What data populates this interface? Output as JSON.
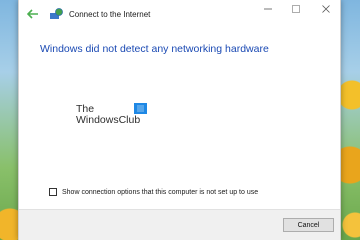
{
  "window": {
    "title": "Connect to the Internet"
  },
  "content": {
    "heading": "Windows did not detect any networking hardware",
    "watermark_line1": "The",
    "watermark_line2": "WindowsClub"
  },
  "option": {
    "label": "Show connection options that this computer is not set up to use",
    "checked": false
  },
  "footer": {
    "cancel_label": "Cancel"
  },
  "colors": {
    "heading": "#1a49b3",
    "back_arrow": "#4caf50"
  },
  "icons": {
    "back": "back-arrow-icon",
    "app": "network-globe-icon",
    "minimize": "minimize-icon",
    "maximize": "maximize-icon",
    "close": "close-icon"
  }
}
